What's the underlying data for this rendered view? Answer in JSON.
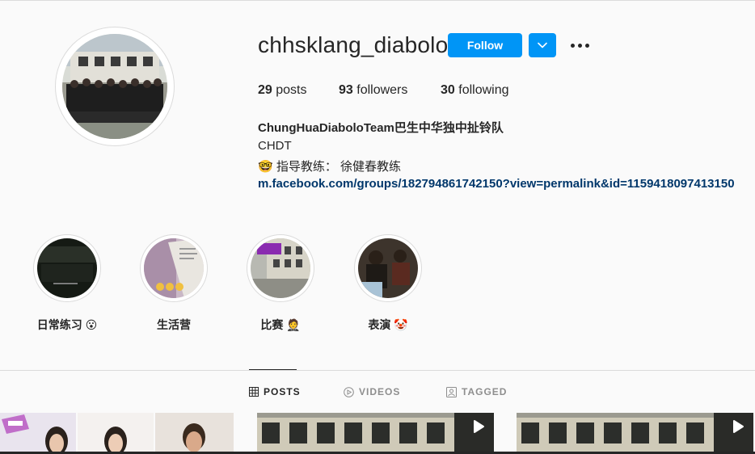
{
  "profile": {
    "username": "chhsklang_diabolo",
    "follow_label": "Follow"
  },
  "stats": {
    "posts_count": "29",
    "posts_label": "posts",
    "followers_count": "93",
    "followers_label": "followers",
    "following_count": "30",
    "following_label": "following"
  },
  "bio": {
    "full_name": "ChungHuaDiaboloTeam巴生中华独中扯铃队",
    "line1": "CHDT",
    "line2_emoji": "🤓",
    "line2_text": "指导教练： 徐健春教练",
    "link": "m.facebook.com/groups/182794861742150?view=permalink&id=1159418097413150"
  },
  "highlights": [
    {
      "label": "日常练习",
      "emoji": "😮"
    },
    {
      "label": "生活营",
      "emoji": ""
    },
    {
      "label": "比赛",
      "emoji": "🤵"
    },
    {
      "label": "表演",
      "emoji": "🤡"
    }
  ],
  "tabs": [
    {
      "label": "POSTS",
      "active": true,
      "icon": "grid-icon"
    },
    {
      "label": "VIDEOS",
      "active": false,
      "icon": "video-icon"
    },
    {
      "label": "TAGGED",
      "active": false,
      "icon": "tag-icon"
    }
  ],
  "colors": {
    "accent": "#0095f6",
    "link": "#00376b",
    "text": "#262626",
    "muted": "#8e8e8e",
    "border": "#dbdbdb",
    "background": "#fafafa"
  }
}
